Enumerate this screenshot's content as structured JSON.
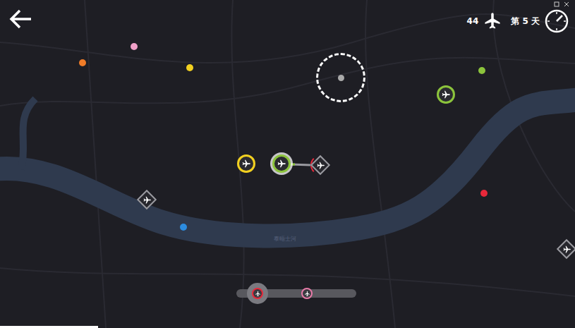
{
  "hud": {
    "plane_count": "44",
    "day": "第 5 天"
  },
  "map": {
    "river_label": "泰晤士河"
  },
  "destinations": [
    {
      "color": "#f07c28"
    },
    {
      "color": "#f0a0c8"
    },
    {
      "color": "#f2d020"
    },
    {
      "color": "#8cc43c"
    },
    {
      "color": "#e8283a"
    },
    {
      "color": "#2c8ce0"
    }
  ],
  "planes": [
    {
      "color": "#f2d020",
      "selected": false
    },
    {
      "color": "#8cc43c",
      "selected": true
    },
    {
      "color": "#8cc43c",
      "selected": false
    }
  ],
  "runways": [
    {
      "occupied": false
    },
    {
      "occupied": true
    },
    {
      "occupied": false
    }
  ],
  "queue": [
    {
      "color": "#e8283a",
      "selected": true
    },
    {
      "color": "#e77aa8",
      "selected": false
    }
  ],
  "day_progress": {
    "level": 0.17
  }
}
